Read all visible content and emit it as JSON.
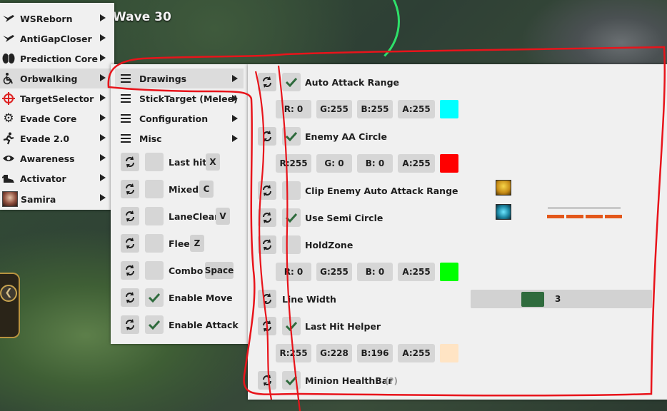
{
  "game": {
    "wave_label": "Wave 30"
  },
  "main_menu": {
    "items": [
      {
        "label": "WSReborn",
        "icon": "bird-icon"
      },
      {
        "label": "AntiGapCloser",
        "icon": "bird-icon"
      },
      {
        "label": "Prediction Core",
        "icon": "brain-icon"
      },
      {
        "label": "Orbwalking",
        "icon": "wheelchair-icon"
      },
      {
        "label": "TargetSelector",
        "icon": "crosshair-icon"
      },
      {
        "label": "Evade Core",
        "icon": "gear-icon"
      },
      {
        "label": "Evade 2.0",
        "icon": "running-icon"
      },
      {
        "label": "Awareness",
        "icon": "eye-icon"
      },
      {
        "label": "Activator",
        "icon": "shoe-icon"
      },
      {
        "label": "Samira",
        "icon": "champion-portrait-icon"
      }
    ]
  },
  "orbwalking_menu": {
    "submenus": [
      {
        "label": "Drawings"
      },
      {
        "label": "StickTarget (Melee)"
      },
      {
        "label": "Configuration"
      },
      {
        "label": "Misc"
      }
    ],
    "settings": [
      {
        "label": "Last hit",
        "key": "X",
        "checked": false
      },
      {
        "label": "Mixed",
        "key": "C",
        "checked": false
      },
      {
        "label": "LaneClear",
        "key": "V",
        "checked": false
      },
      {
        "label": "Flee",
        "key": "Z",
        "checked": false
      },
      {
        "label": "Combo",
        "key": "Space",
        "checked": false
      },
      {
        "label": "Enable Move",
        "key": "",
        "checked": true
      },
      {
        "label": "Enable Attack",
        "key": "",
        "checked": true
      }
    ]
  },
  "drawings": {
    "auto_attack_range": {
      "label": "Auto Attack Range",
      "checked": true,
      "r": "R:  0",
      "g": "G:255",
      "b": "B:255",
      "a": "A:255",
      "color": "#00ffff"
    },
    "enemy_aa_circle": {
      "label": "Enemy AA Circle",
      "checked": true,
      "r": "R:255",
      "g": "G:  0",
      "b": "B:  0",
      "a": "A:255",
      "color": "#ff0000"
    },
    "clip_enemy": {
      "label": "Clip Enemy Auto Attack Range",
      "checked": false
    },
    "semi_circle": {
      "label": "Use Semi Circle",
      "checked": true
    },
    "holdzone": {
      "label": "HoldZone",
      "checked": false,
      "r": "R:  0",
      "g": "G:255",
      "b": "B:  0",
      "a": "A:255",
      "color": "#00ff00"
    },
    "line_width": {
      "label": "Line Width",
      "value": "3",
      "fraction": 0.3
    },
    "last_hit_helper": {
      "label": "Last Hit Helper",
      "checked": true,
      "r": "R:255",
      "g": "G:228",
      "b": "B:196",
      "a": "A:255",
      "color": "#ffe4c4"
    },
    "minion_healthbar": {
      "label": "Minion HealthBar",
      "checked": true,
      "help": "(?)"
    }
  }
}
